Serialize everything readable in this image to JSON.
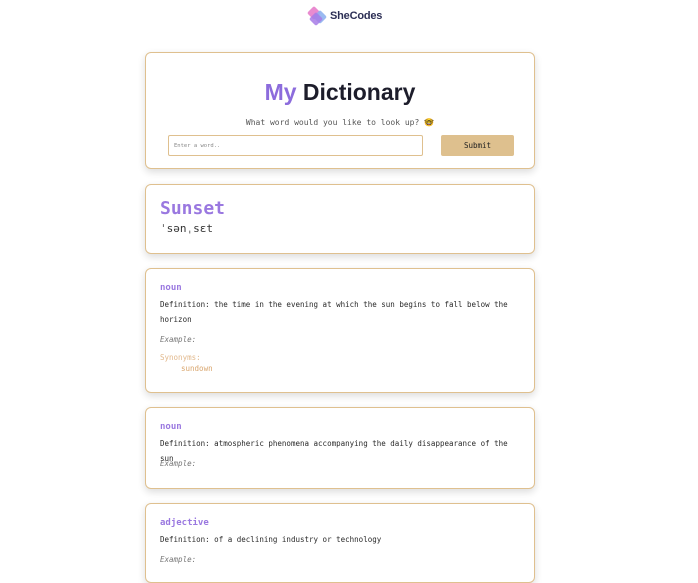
{
  "logo": {
    "text": "SheCodes"
  },
  "header": {
    "title_accent": "My",
    "title_main": "Dictionary",
    "subtitle": "What word would you like to look up? 🤓"
  },
  "search": {
    "placeholder": "Enter a word..",
    "value": "",
    "submit_label": "Submit"
  },
  "word": {
    "text": "Sunset",
    "phonetic": "ˈsənˌsɛt"
  },
  "meanings": [
    {
      "part_of_speech": "noun",
      "definition": "Definition: the time in the evening at which the sun begins to fall below the horizon",
      "example_label": "Example:",
      "synonyms_label": "Synonyms:",
      "synonyms": [
        "sundown"
      ]
    },
    {
      "part_of_speech": "noun",
      "definition": "Definition: atmospheric phenomena accompanying the daily disappearance of the sun",
      "example_label": "Example:"
    },
    {
      "part_of_speech": "adjective",
      "definition": "Definition: of a declining industry or technology",
      "example_label": "Example:"
    }
  ],
  "colors": {
    "accent_purple": "#8c6cdc",
    "gold_border": "#dfc08f",
    "button_bg": "#dec08e"
  }
}
